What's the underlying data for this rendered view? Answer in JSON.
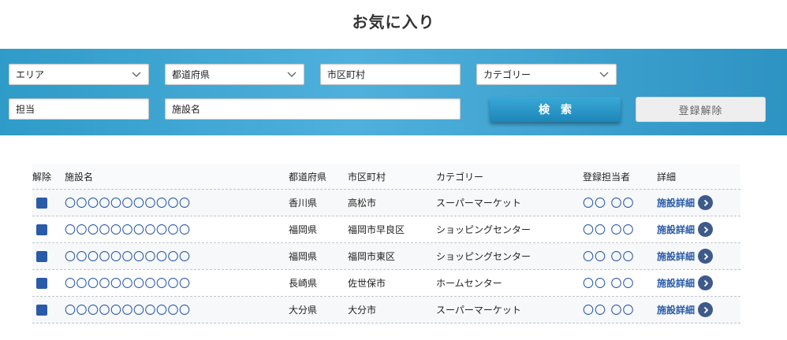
{
  "page": {
    "title": "お気に入り"
  },
  "search": {
    "area": "エリア",
    "prefecture": "都道府県",
    "city": "市区町村",
    "category": "カテゴリー",
    "staff": "担当",
    "facility": "施設名",
    "search_label": "検索",
    "unregister_label": "登録解除"
  },
  "table": {
    "headers": {
      "del": "解除",
      "name": "施設名",
      "pref": "都道府県",
      "city": "市区町村",
      "category": "カテゴリー",
      "staff": "登録担当者",
      "detail": "詳細"
    },
    "rows": [
      {
        "name": "〇〇〇〇〇〇〇〇〇〇〇",
        "pref": "香川県",
        "city": "高松市",
        "category": "スーパーマーケット",
        "staff": "〇〇 〇〇",
        "detail": "施設詳細"
      },
      {
        "name": "〇〇〇〇〇〇〇〇〇〇〇",
        "pref": "福岡県",
        "city": "福岡市早良区",
        "category": "ショッピングセンター",
        "staff": "〇〇 〇〇",
        "detail": "施設詳細"
      },
      {
        "name": "〇〇〇〇〇〇〇〇〇〇〇",
        "pref": "福岡県",
        "city": "福岡市東区",
        "category": "ショッピングセンター",
        "staff": "〇〇 〇〇",
        "detail": "施設詳細"
      },
      {
        "name": "〇〇〇〇〇〇〇〇〇〇〇",
        "pref": "長崎県",
        "city": "佐世保市",
        "category": "ホームセンター",
        "staff": "〇〇 〇〇",
        "detail": "施設詳細"
      },
      {
        "name": "〇〇〇〇〇〇〇〇〇〇〇",
        "pref": "大分県",
        "city": "大分市",
        "category": "スーパーマーケット",
        "staff": "〇〇 〇〇",
        "detail": "施設詳細"
      }
    ]
  },
  "icons": {
    "select_chevron": "chevron-down-icon",
    "detail": "chevron-right-circle-icon"
  },
  "colors": {
    "panel": "#3aa6d6",
    "link": "#2a5ba8",
    "checkbox": "#2a5ba8"
  }
}
